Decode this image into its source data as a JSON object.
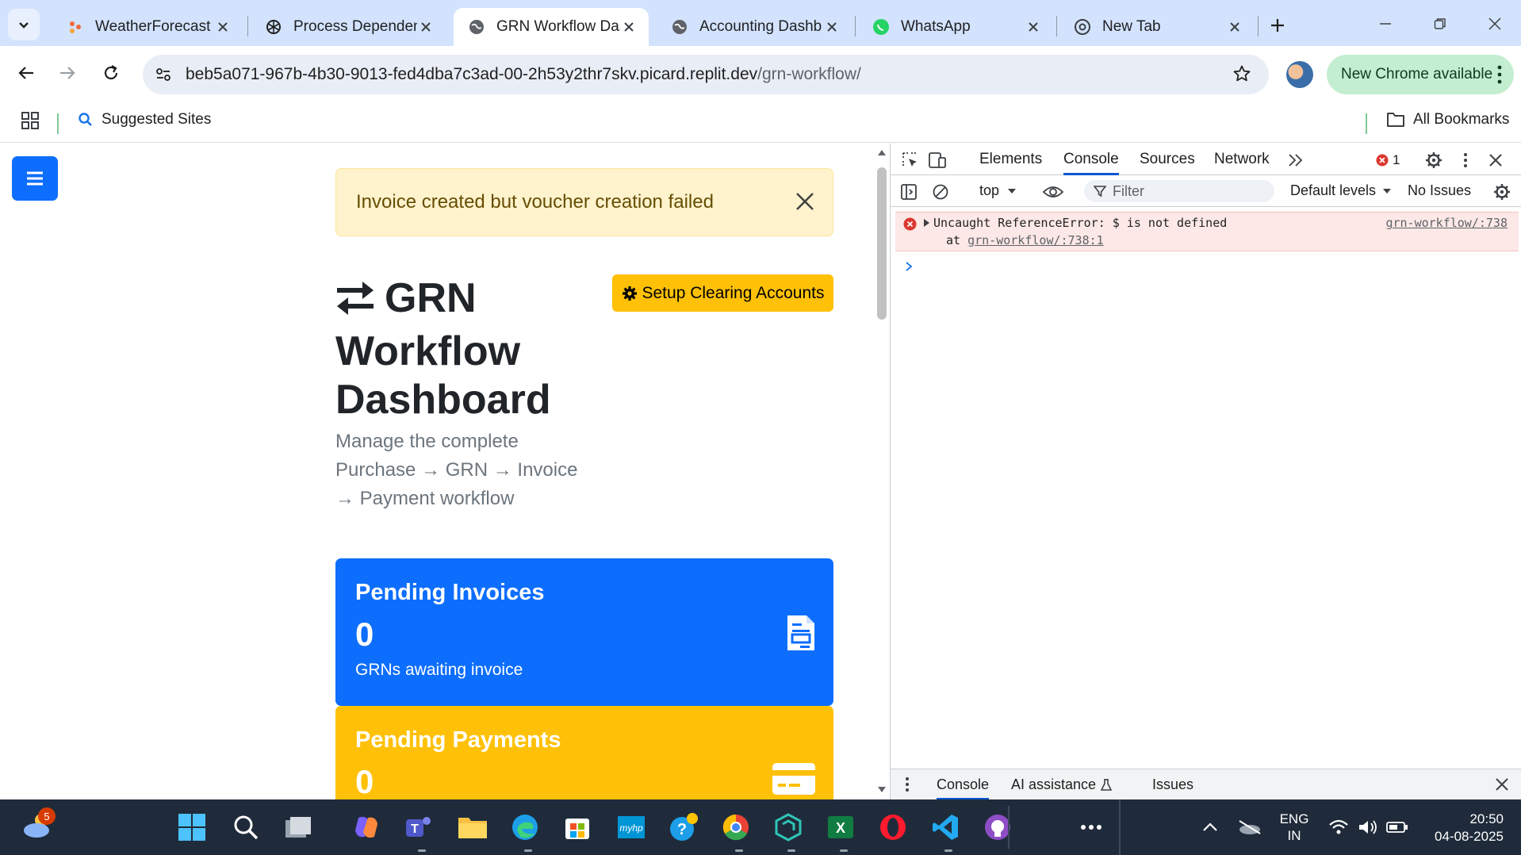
{
  "browser": {
    "tabs": [
      {
        "title": "WeatherForecast -",
        "active": false
      },
      {
        "title": "Process Dependen",
        "active": false
      },
      {
        "title": "GRN Workflow Das",
        "active": true
      },
      {
        "title": "Accounting Dashb",
        "active": false
      },
      {
        "title": "WhatsApp",
        "active": false
      },
      {
        "title": "New Tab",
        "active": false
      }
    ],
    "url_host": "beb5a071-967b-4b30-9013-fed4dba7c3ad-00-2h53y2thr7skv.picard.replit.dev",
    "url_path": "/grn-workflow/",
    "new_chrome_label": "New Chrome available",
    "bookmarks": {
      "suggested": "Suggested Sites",
      "all": "All Bookmarks"
    }
  },
  "page": {
    "alert_text": "Invoice created but voucher creation failed",
    "setup_button": "Setup Clearing Accounts",
    "title": "GRN Workflow Dashboard",
    "subtitle": "Manage the complete Purchase → GRN → Invoice → Payment workflow",
    "cards": [
      {
        "title": "Pending Invoices",
        "value": "0",
        "sub": "GRNs awaiting invoice",
        "color": "#0d6efd"
      },
      {
        "title": "Pending Payments",
        "value": "0",
        "sub": "",
        "color": "#ffc107"
      }
    ]
  },
  "devtools": {
    "tabs": [
      "Elements",
      "Console",
      "Sources",
      "Network"
    ],
    "active_tab": "Console",
    "error_count": "1",
    "context": "top",
    "filter_placeholder": "Filter",
    "levels": "Default levels",
    "issues": "No Issues",
    "error": {
      "message": "Uncaught ReferenceError: $ is not defined",
      "source": "grn-workflow/:738",
      "at_prefix": "at",
      "at_link": "grn-workflow/:738:1"
    },
    "drawer_tabs": [
      "Console",
      "AI assistance",
      "Issues"
    ]
  },
  "taskbar": {
    "weather_badge": "5",
    "lang": "ENG",
    "region": "IN",
    "time": "20:50",
    "date": "04-08-2025"
  }
}
